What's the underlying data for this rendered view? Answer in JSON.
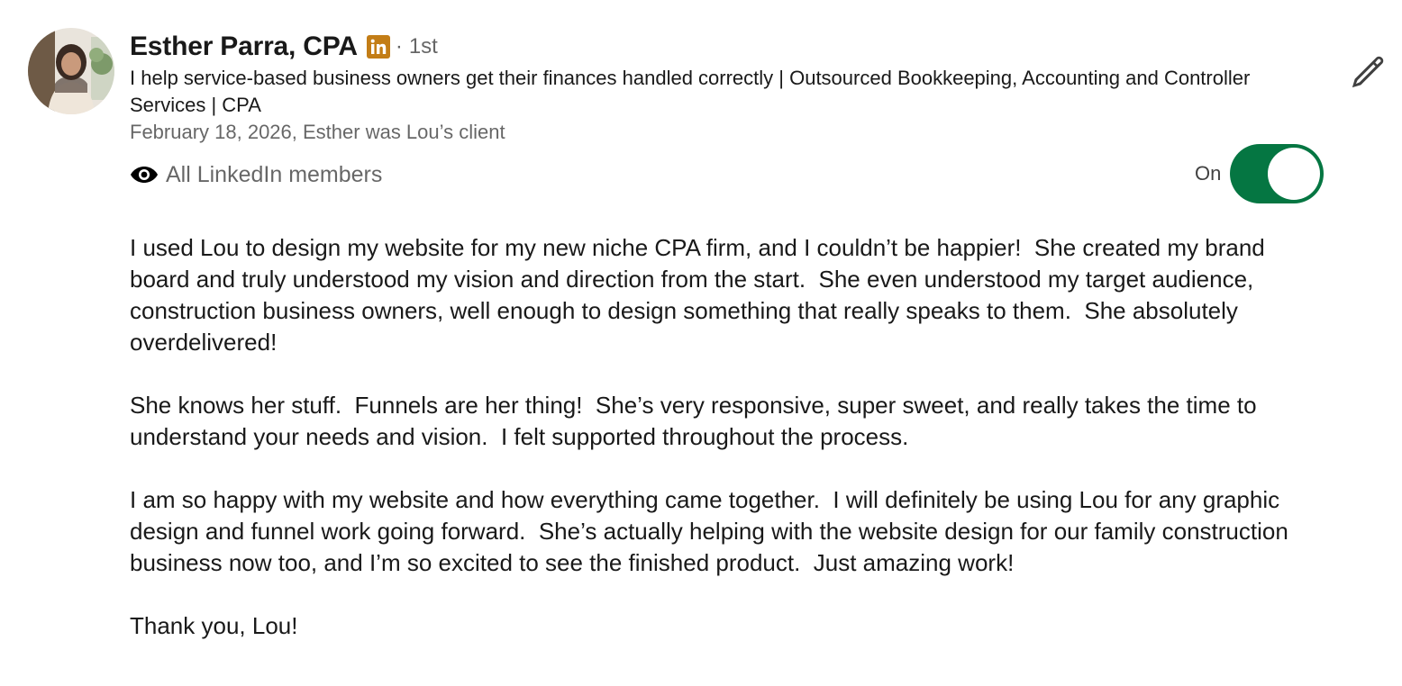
{
  "recommender": {
    "name": "Esther Parra, CPA",
    "degree_separator": "·",
    "degree": "1st",
    "headline": "I help service-based business owners get their finances handled correctly | Outsourced Bookkeeping, Accounting and Controller Services | CPA",
    "meta": "February 18, 2026, Esther was Lou’s client",
    "badge_icon": "linkedin-icon",
    "badge_color": "#C37D16"
  },
  "visibility": {
    "icon": "eye-icon",
    "label": "All LinkedIn members",
    "toggle_label": "On",
    "toggle_state": true,
    "toggle_color": "#057642"
  },
  "actions": {
    "edit_icon": "pencil-icon"
  },
  "recommendation": {
    "paragraphs": [
      "I used Lou to design my website for my new niche CPA firm, and I couldn’t be happier!  She created my brand board and truly understood my vision and direction from the start.  She even understood my target audience, construction business owners, well enough to design something that really speaks to them.  She absolutely overdelivered!",
      "She knows her stuff.  Funnels are her thing!  She’s very responsive, super sweet, and really takes the time to understand your needs and vision.  I felt supported throughout the process.",
      "I am so happy with my website and how everything came together.  I will definitely be using Lou for any graphic design and funnel work going forward.  She’s actually helping with the website design for our family construction business now too, and I’m so excited to see the finished product.  Just amazing work!",
      "Thank you, Lou!"
    ]
  }
}
